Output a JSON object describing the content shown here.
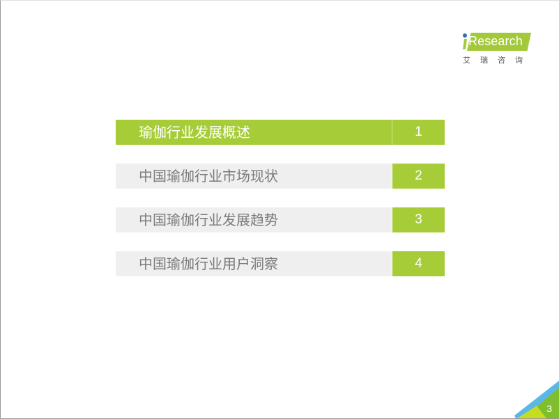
{
  "logo": {
    "brand": "Research",
    "brand_prefix": "i",
    "chinese": "艾瑞咨询",
    "brand_color": "#a3c93a"
  },
  "toc": {
    "accent_color": "#a6cc38",
    "inactive_bg": "#efefef",
    "items": [
      {
        "label": "瑜伽行业发展概述",
        "number": "1",
        "active": true
      },
      {
        "label": "中国瑜伽行业市场现状",
        "number": "2",
        "active": false
      },
      {
        "label": "中国瑜伽行业发展趋势",
        "number": "3",
        "active": false
      },
      {
        "label": "中国瑜伽行业用户洞察",
        "number": "4",
        "active": false
      }
    ]
  },
  "footer": {
    "page_number": "3"
  }
}
